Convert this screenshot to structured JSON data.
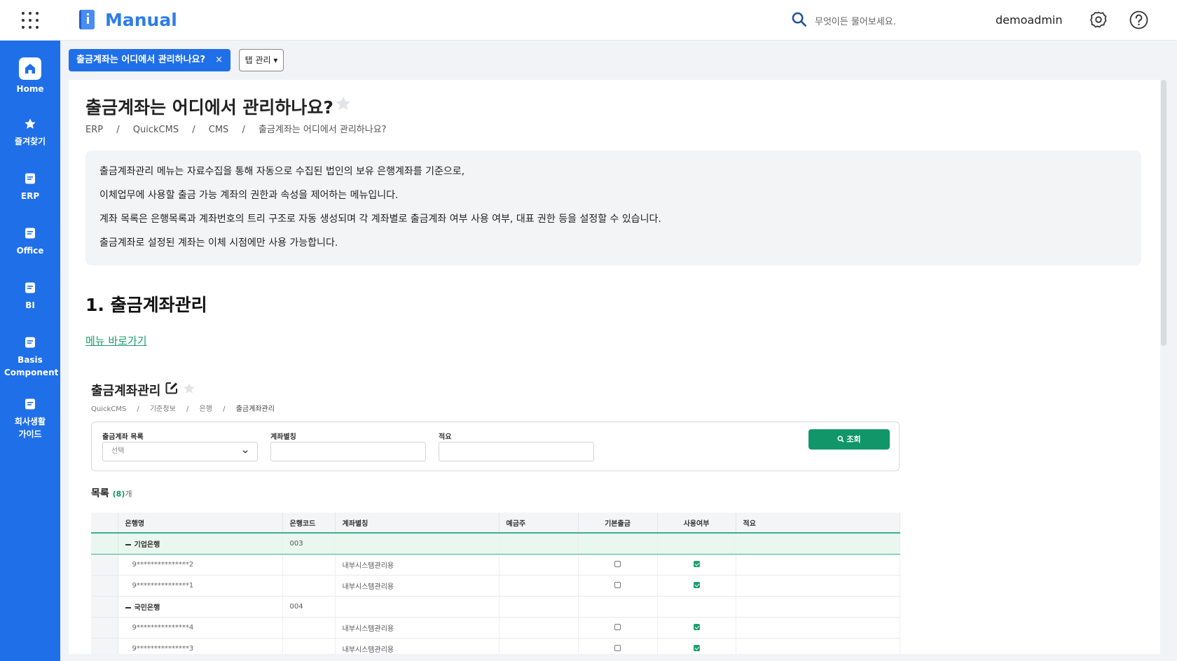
{
  "app": {
    "title": "Manual"
  },
  "header": {
    "search_placeholder": "무엇이든 물어보세요.",
    "username": "demoadmin"
  },
  "sidebar": {
    "items": [
      {
        "label": "Home",
        "icon": "home-icon"
      },
      {
        "label": "즐겨찾기",
        "icon": "star-icon"
      },
      {
        "label": "ERP",
        "icon": "document-icon"
      },
      {
        "label": "Office",
        "icon": "document-icon"
      },
      {
        "label": "BI",
        "icon": "document-icon"
      },
      {
        "label": "Basis Component",
        "icon": "document-icon"
      },
      {
        "label": "회사생활 가이드",
        "icon": "document-icon"
      }
    ]
  },
  "tabs": {
    "active_label": "출금계좌는 어디에서 관리하나요?",
    "close": "×",
    "manage_label": "탭 관리 ▾"
  },
  "page": {
    "title": "출금계좌는 어디에서 관리하나요?",
    "breadcrumb": [
      "ERP",
      "QuickCMS",
      "CMS",
      "출금계좌는 어디에서 관리하나요?"
    ],
    "breadcrumb_sep": "/",
    "description": [
      "출금계좌관리 메뉴는 자료수집을 통해 자동으로 수집된 법인의 보유 은행계좌를 기준으로,",
      "이체업무에 사용할 출금 가능 계좌의 권한과 속성을 제어하는 메뉴입니다.",
      "계좌 목록은 은행목록과 계좌번호의 트리 구조로 자동 생성되며 각 계좌별로 출금계좌 여부 사용 여부, 대표 권한 등을 설정할 수 있습니다.",
      "출금계좌로 설정된 계좌는 이체 시점에만 사용 가능합니다."
    ],
    "section_title": "1. 출금계좌관리",
    "menu_link": "메뉴 바로가기"
  },
  "embedded": {
    "title": "출금계좌관리",
    "breadcrumb": [
      "QuickCMS",
      "기준정보",
      "은행",
      "출금계좌관리"
    ],
    "filters": {
      "account_list_label": "출금계좌 목록",
      "account_list_value": "선택",
      "alias_label": "계좌별칭",
      "alias_value": "",
      "memo_label": "적요",
      "memo_value": ""
    },
    "query_button": "조회",
    "list_label": "목록",
    "list_count": "(8)",
    "list_unit": "개",
    "columns": [
      "은행명",
      "은행코드",
      "계좌별칭",
      "예금주",
      "기본출금",
      "사용여부",
      "적요"
    ],
    "rows": [
      {
        "type": "group",
        "bank": "기업은행",
        "code": "003",
        "selected": true
      },
      {
        "type": "account",
        "account": "9***************2",
        "alias": "내부시스템관리용",
        "default": false,
        "use": true
      },
      {
        "type": "account",
        "account": "9***************1",
        "alias": "내부시스템관리용",
        "default": false,
        "use": true
      },
      {
        "type": "group",
        "bank": "국민은행",
        "code": "004",
        "selected": false
      },
      {
        "type": "account",
        "account": "9***************4",
        "alias": "내부시스템관리용",
        "default": false,
        "use": true
      },
      {
        "type": "account",
        "account": "9***************3",
        "alias": "내부시스템관리용",
        "default": false,
        "use": true
      }
    ]
  },
  "colors": {
    "brand": "#1f6fe8",
    "accent_green": "#11966a",
    "link": "#1a9a6a"
  }
}
